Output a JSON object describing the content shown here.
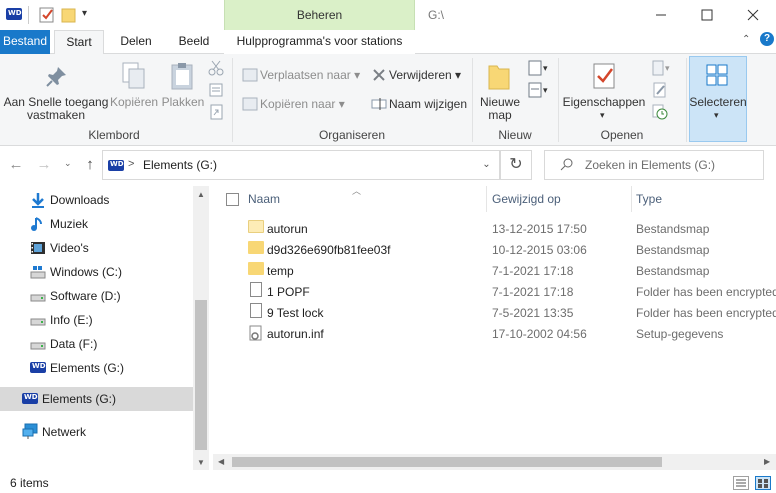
{
  "window": {
    "context_group": "Beheren",
    "title": "G:\\",
    "min_icon": "minimize-icon",
    "max_icon": "maximize-icon",
    "close_icon": "close-icon"
  },
  "tabs": {
    "file": "Bestand",
    "home": "Start",
    "share": "Delen",
    "view": "Beeld",
    "drive_tools": "Hulpprogramma's voor stations"
  },
  "ribbon": {
    "pin": "Aan Snelle toegang vastmaken",
    "copy": "Kopiëren",
    "paste": "Plakken",
    "group_clipboard": "Klembord",
    "move_to": "Verplaatsen naar",
    "copy_to": "Kopiëren naar",
    "delete": "Verwijderen",
    "rename": "Naam wijzigen",
    "group_organize": "Organiseren",
    "new_folder": "Nieuwe map",
    "group_new": "Nieuw",
    "properties": "Eigenschappen",
    "group_open": "Openen",
    "select": "Selecteren"
  },
  "address": {
    "path_sep": ">",
    "location": "Elements (G:)",
    "search_placeholder": "Zoeken in Elements (G:)"
  },
  "nav": {
    "items": [
      {
        "label": "Downloads",
        "icon": "download-icon"
      },
      {
        "label": "Muziek",
        "icon": "music-icon"
      },
      {
        "label": "Video's",
        "icon": "video-icon"
      },
      {
        "label": "Windows (C:)",
        "icon": "drive-icon"
      },
      {
        "label": "Software (D:)",
        "icon": "drive-icon"
      },
      {
        "label": "Info (E:)",
        "icon": "drive-icon"
      },
      {
        "label": "Data (F:)",
        "icon": "drive-icon"
      },
      {
        "label": "Elements (G:)",
        "icon": "wd-drive-icon"
      }
    ],
    "selected": "Elements (G:)",
    "network": "Netwerk"
  },
  "list": {
    "columns": {
      "name": "Naam",
      "modified": "Gewijzigd op",
      "type": "Type"
    },
    "rows": [
      {
        "name": "autorun",
        "modified": "13-12-2015 17:50",
        "type": "Bestandsmap",
        "icon": "folder-icon"
      },
      {
        "name": "d9d326e690fb81fee03f",
        "modified": "10-12-2015 03:06",
        "type": "Bestandsmap",
        "icon": "folder-icon"
      },
      {
        "name": "temp",
        "modified": "7-1-2021 17:18",
        "type": "Bestandsmap",
        "icon": "folder-icon"
      },
      {
        "name": "1 POPF",
        "modified": "7-1-2021 17:18",
        "type": "Folder has been encrypted",
        "icon": "file-icon"
      },
      {
        "name": "9 Test lock",
        "modified": "7-5-2021 13:35",
        "type": "Folder has been encrypted",
        "icon": "file-icon"
      },
      {
        "name": "autorun.inf",
        "modified": "17-10-2002 04:56",
        "type": "Setup-gegevens",
        "icon": "settings-file-icon"
      }
    ]
  },
  "status": {
    "count": "6 items"
  }
}
